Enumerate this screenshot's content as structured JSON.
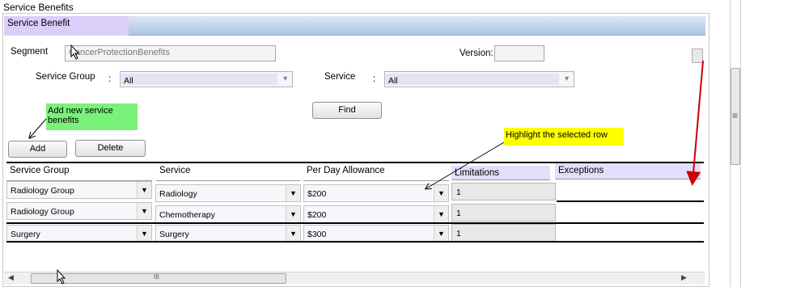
{
  "window": {
    "title": "Service Benefits"
  },
  "panel": {
    "title": "Service Benefit"
  },
  "form": {
    "segment_label": "Segment",
    "segment_value": "CancerProtectionBenefits",
    "version_label": "Version:",
    "version_value": "",
    "service_group_label": "Service Group",
    "service_group_colon": ":",
    "service_group_value": "All",
    "service_label": "Service",
    "service_colon": ":",
    "service_value": "All",
    "find_label": "Find",
    "add_label": "Add",
    "delete_label": "Delete"
  },
  "annotations": {
    "add_note": "Add new service benefits",
    "highlight_note": "Highlight the selected row"
  },
  "grid": {
    "columns": [
      "Service Group",
      "Service",
      "Per Day Allowance",
      "Limitations",
      "Exceptions"
    ],
    "rows": [
      {
        "group": "Radiology Group",
        "service": "Radiology",
        "allowance": "$200",
        "limitations": "1",
        "exceptions": ""
      },
      {
        "group": "Radiology Group",
        "service": "Chemotherapy",
        "allowance": "$200",
        "limitations": "1",
        "exceptions": ""
      },
      {
        "group": "Surgery",
        "service": "Surgery",
        "allowance": "$300",
        "limitations": "1",
        "exceptions": ""
      }
    ]
  },
  "scrollbars": {
    "grip_glyph": "≡",
    "hgrip_glyph": "III"
  },
  "icons": {
    "dropdown": "chevron-down-icon",
    "left": "arrow-left-icon",
    "right": "arrow-right-icon"
  },
  "colors": {
    "panel_title_bg": "#dccdfa",
    "green_callout": "#79f279",
    "yellow_callout": "#ffff00",
    "arrow_red": "#cc0000"
  }
}
